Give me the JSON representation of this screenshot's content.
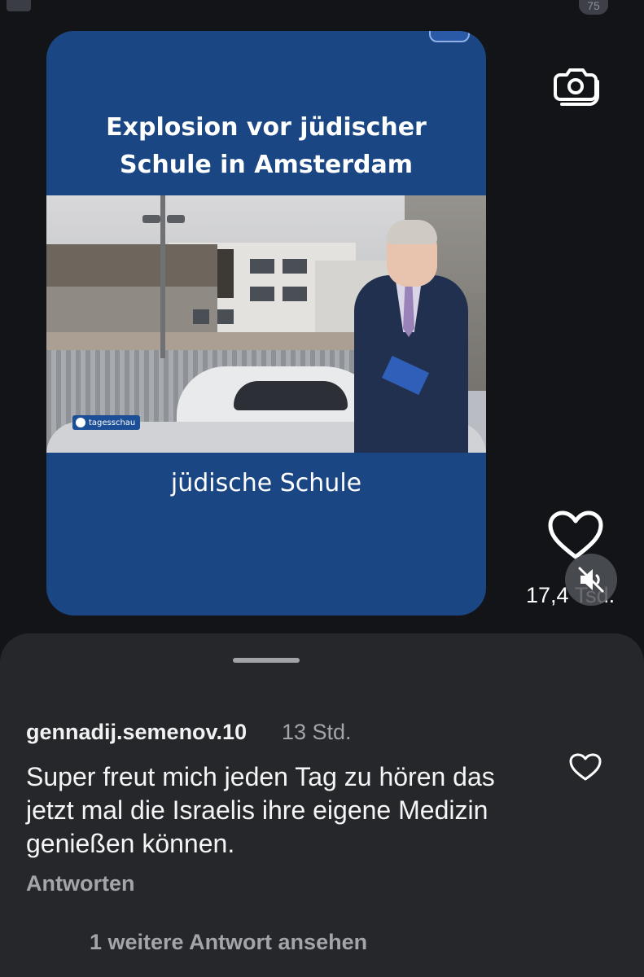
{
  "status_bar": {
    "battery": "75"
  },
  "video": {
    "headline_line1": "Explosion vor jüdischer",
    "headline_line2": "Schule in Amsterdam",
    "channel_logo": "tagesschau",
    "lower_third": "jüdische Schule"
  },
  "actions": {
    "camera_icon": "camera-icon",
    "like_icon": "heart-icon",
    "like_count": "17,4 Tsd.",
    "mute_icon": "speaker-muted-icon"
  },
  "comments": {
    "items": [
      {
        "username": "gennadij.semenov.10",
        "time": "13 Std.",
        "text": "Super freut mich jeden Tag zu hören das jetzt mal die Israelis ihre eigene Medizin genießen können.",
        "reply_label": "Antworten"
      }
    ],
    "more_replies": "1 weitere Antwort ansehen"
  },
  "colors": {
    "background": "#121418",
    "card_blue": "#1b4684",
    "sheet": "#25272b",
    "muted_text": "#a3a5aa"
  }
}
